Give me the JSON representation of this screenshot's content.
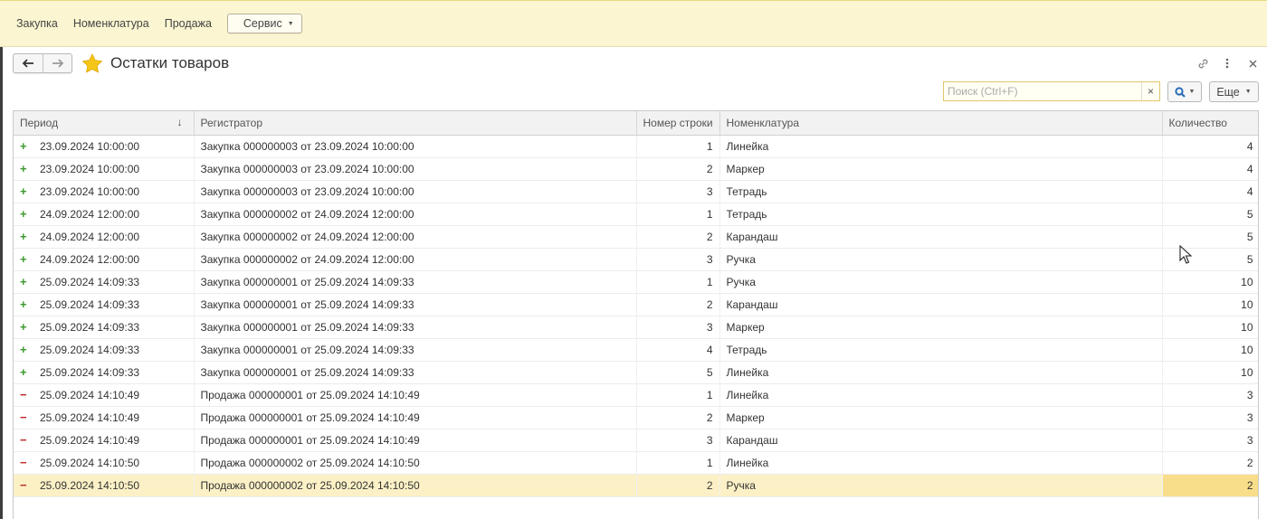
{
  "sections": {
    "items": [
      "Закупка",
      "Номенклатура",
      "Продажа"
    ],
    "service_label": "Сервис"
  },
  "form": {
    "title": "Остатки товаров"
  },
  "commandbar": {
    "search_placeholder": "Поиск (Ctrl+F)",
    "more_label": "Еще"
  },
  "table": {
    "columns": [
      "Период",
      "Регистратор",
      "Номер строки",
      "Номенклатура",
      "Количество"
    ],
    "sort_indicator": "↓",
    "rows": [
      {
        "type": "plus",
        "period": "23.09.2024 10:00:00",
        "registrar": "Закупка 000000003 от 23.09.2024 10:00:00",
        "line": "1",
        "item": "Линейка",
        "qty": "4"
      },
      {
        "type": "plus",
        "period": "23.09.2024 10:00:00",
        "registrar": "Закупка 000000003 от 23.09.2024 10:00:00",
        "line": "2",
        "item": "Маркер",
        "qty": "4"
      },
      {
        "type": "plus",
        "period": "23.09.2024 10:00:00",
        "registrar": "Закупка 000000003 от 23.09.2024 10:00:00",
        "line": "3",
        "item": "Тетрадь",
        "qty": "4"
      },
      {
        "type": "plus",
        "period": "24.09.2024 12:00:00",
        "registrar": "Закупка 000000002 от 24.09.2024 12:00:00",
        "line": "1",
        "item": "Тетрадь",
        "qty": "5"
      },
      {
        "type": "plus",
        "period": "24.09.2024 12:00:00",
        "registrar": "Закупка 000000002 от 24.09.2024 12:00:00",
        "line": "2",
        "item": "Карандаш",
        "qty": "5"
      },
      {
        "type": "plus",
        "period": "24.09.2024 12:00:00",
        "registrar": "Закупка 000000002 от 24.09.2024 12:00:00",
        "line": "3",
        "item": "Ручка",
        "qty": "5"
      },
      {
        "type": "plus",
        "period": "25.09.2024 14:09:33",
        "registrar": "Закупка 000000001 от 25.09.2024 14:09:33",
        "line": "1",
        "item": "Ручка",
        "qty": "10"
      },
      {
        "type": "plus",
        "period": "25.09.2024 14:09:33",
        "registrar": "Закупка 000000001 от 25.09.2024 14:09:33",
        "line": "2",
        "item": "Карандаш",
        "qty": "10"
      },
      {
        "type": "plus",
        "period": "25.09.2024 14:09:33",
        "registrar": "Закупка 000000001 от 25.09.2024 14:09:33",
        "line": "3",
        "item": "Маркер",
        "qty": "10"
      },
      {
        "type": "plus",
        "period": "25.09.2024 14:09:33",
        "registrar": "Закупка 000000001 от 25.09.2024 14:09:33",
        "line": "4",
        "item": "Тетрадь",
        "qty": "10"
      },
      {
        "type": "plus",
        "period": "25.09.2024 14:09:33",
        "registrar": "Закупка 000000001 от 25.09.2024 14:09:33",
        "line": "5",
        "item": "Линейка",
        "qty": "10"
      },
      {
        "type": "minus",
        "period": "25.09.2024 14:10:49",
        "registrar": "Продажа 000000001 от 25.09.2024 14:10:49",
        "line": "1",
        "item": "Линейка",
        "qty": "3"
      },
      {
        "type": "minus",
        "period": "25.09.2024 14:10:49",
        "registrar": "Продажа 000000001 от 25.09.2024 14:10:49",
        "line": "2",
        "item": "Маркер",
        "qty": "3"
      },
      {
        "type": "minus",
        "period": "25.09.2024 14:10:49",
        "registrar": "Продажа 000000001 от 25.09.2024 14:10:49",
        "line": "3",
        "item": "Карандаш",
        "qty": "3"
      },
      {
        "type": "minus",
        "period": "25.09.2024 14:10:50",
        "registrar": "Продажа 000000002 от 25.09.2024 14:10:50",
        "line": "1",
        "item": "Линейка",
        "qty": "2"
      },
      {
        "type": "minus",
        "period": "25.09.2024 14:10:50",
        "registrar": "Продажа 000000002 от 25.09.2024 14:10:50",
        "line": "2",
        "item": "Ручка",
        "qty": "2",
        "selected": true
      }
    ]
  },
  "icons": {
    "back": "arrow-left-icon",
    "forward": "arrow-right-icon",
    "favorite": "star-icon",
    "link": "link-icon",
    "more": "more-vertical-icon",
    "close": "close-icon",
    "search": "search-icon",
    "income": "plus-icon",
    "expense": "minus-icon"
  },
  "colors": {
    "section_panel": "#fbf6d1",
    "selected_row": "#fcf1c6",
    "selected_cell": "#f8de8b",
    "income_sign": "#3c9a2e",
    "expense_sign": "#c0262c",
    "favorite_star": "#f5c518"
  }
}
